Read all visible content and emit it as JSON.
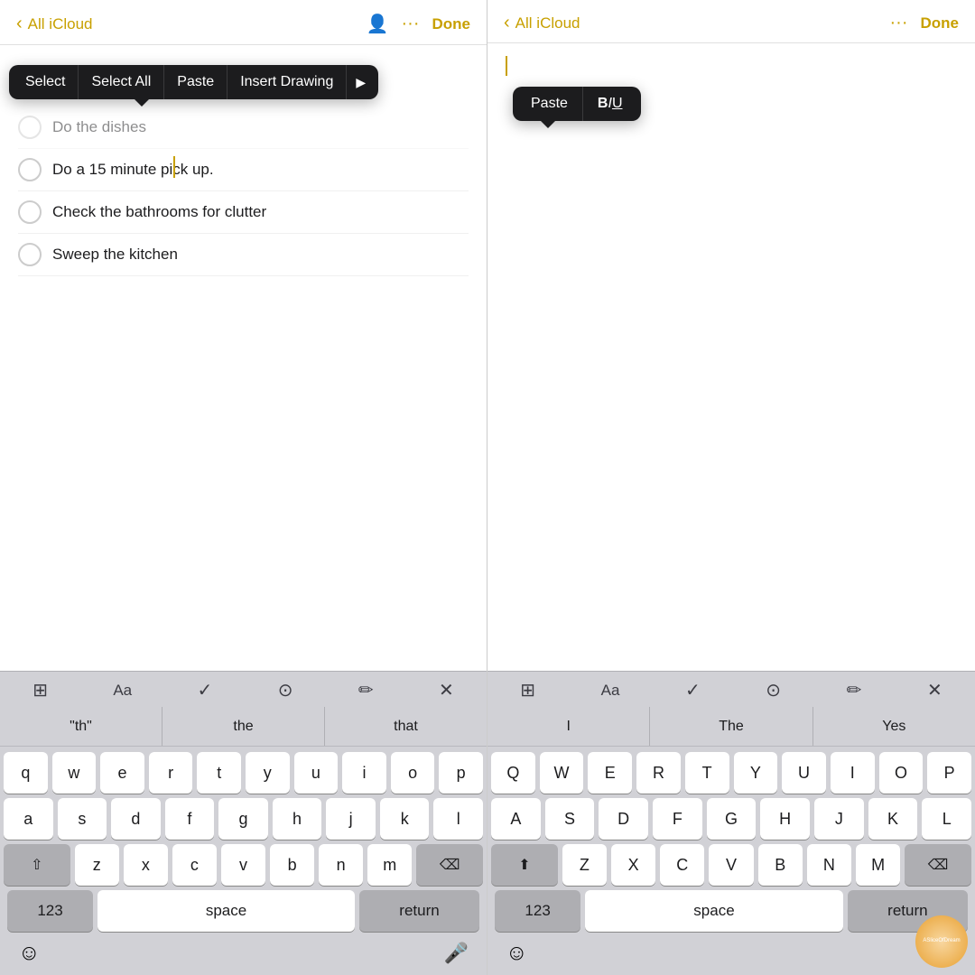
{
  "left_panel": {
    "nav": {
      "back_label": "All iCloud",
      "done_label": "Done"
    },
    "context_menu": {
      "items": [
        "Select",
        "Select All",
        "Paste",
        "Insert Drawing"
      ]
    },
    "checklist": {
      "items": [
        {
          "text": "Do the dishes",
          "checked": false,
          "dimmed": true
        },
        {
          "text": "Do a 15 minute pick up.",
          "checked": false,
          "dimmed": false
        },
        {
          "text": "Check the bathrooms for clutter",
          "checked": false,
          "dimmed": false
        },
        {
          "text": "Sweep the kitchen",
          "checked": false,
          "dimmed": false
        }
      ]
    },
    "autocomplete": {
      "items": [
        "\"th\"",
        "the",
        "that"
      ]
    },
    "keyboard": {
      "rows": [
        [
          "q",
          "w",
          "e",
          "r",
          "t",
          "y",
          "u",
          "i",
          "o",
          "p"
        ],
        [
          "a",
          "s",
          "d",
          "f",
          "g",
          "h",
          "j",
          "k",
          "l"
        ],
        [
          "z",
          "x",
          "c",
          "v",
          "b",
          "n",
          "m"
        ]
      ],
      "bottom": {
        "num": "123",
        "space": "space",
        "return": "return"
      }
    },
    "emoji_row": {
      "emoji": "☺",
      "mic": "🎤"
    }
  },
  "right_panel": {
    "nav": {
      "back_label": "All iCloud",
      "done_label": "Done"
    },
    "paste_menu": {
      "items": [
        "Paste",
        "BIU"
      ]
    },
    "autocomplete": {
      "items": [
        "I",
        "The",
        "Yes"
      ]
    },
    "keyboard": {
      "rows": [
        [
          "Q",
          "W",
          "E",
          "R",
          "T",
          "Y",
          "U",
          "I",
          "O",
          "P"
        ],
        [
          "A",
          "S",
          "D",
          "F",
          "G",
          "H",
          "J",
          "K",
          "L"
        ],
        [
          "Z",
          "X",
          "C",
          "V",
          "B",
          "N",
          "M"
        ]
      ],
      "bottom": {
        "num": "123",
        "space": "space",
        "return": "return"
      }
    }
  }
}
